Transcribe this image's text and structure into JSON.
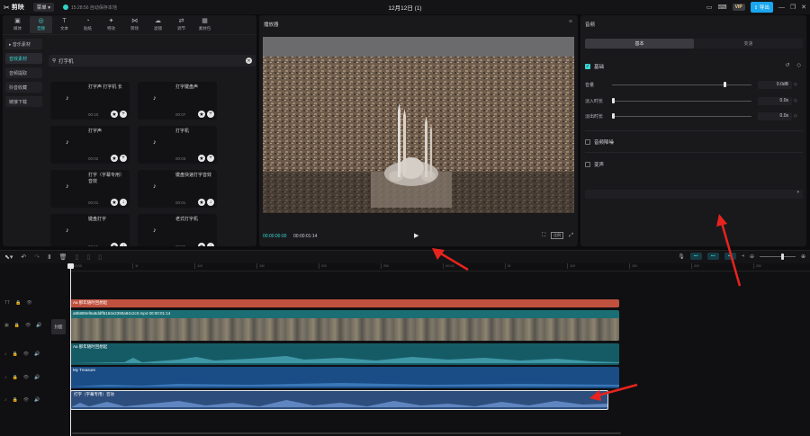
{
  "app": {
    "name": "剪映",
    "menu_label": "菜单",
    "autosave": "15:28:56 自动保存本地",
    "title": "12月12日 (1)",
    "vip": "VIP",
    "export_label": "导出"
  },
  "tools": [
    {
      "icon": "media-icon",
      "glyph": "▣",
      "label": "媒体"
    },
    {
      "icon": "audio-icon",
      "glyph": "◎",
      "label": "音频",
      "active": true
    },
    {
      "icon": "text-icon",
      "glyph": "T",
      "label": "文本"
    },
    {
      "icon": "sticker-icon",
      "glyph": "◔",
      "label": "贴纸"
    },
    {
      "icon": "effects-icon",
      "glyph": "✦",
      "label": "特效"
    },
    {
      "icon": "transition-icon",
      "glyph": "⋈",
      "label": "转场"
    },
    {
      "icon": "filter-icon",
      "glyph": "☁",
      "label": "滤镜"
    },
    {
      "icon": "adjust-icon",
      "glyph": "⇄",
      "label": "调节"
    },
    {
      "icon": "template-icon",
      "glyph": "▦",
      "label": "素材包"
    }
  ],
  "subnav": [
    "▸ 音乐素材",
    "音效素材",
    "音频提取",
    "抖音收藏",
    "链接下载"
  ],
  "search": {
    "value": "打字机"
  },
  "sounds": [
    {
      "name": "打字声 打字机 长",
      "duration": "00:10"
    },
    {
      "name": "打字键盘声",
      "duration": "00:07"
    },
    {
      "name": "打字声",
      "duration": "00:02"
    },
    {
      "name": "打字机",
      "duration": "00:03"
    },
    {
      "name": "打字（字幕专用）音效",
      "duration": "00:01"
    },
    {
      "name": "键盘快速打字音效",
      "duration": "00:01"
    },
    {
      "name": "键盘打字",
      "duration": "00:15"
    },
    {
      "name": "老式打字机",
      "duration": "00:05"
    },
    {
      "name": "键盘打字",
      "duration": ""
    },
    {
      "name": "键盘 慢速打字声",
      "duration": ""
    }
  ],
  "player": {
    "title": "播放器",
    "time_current": "00:00:00:00",
    "time_total": "00:00:01:14",
    "ratio": "比例"
  },
  "right_panel": {
    "title": "音频",
    "tabs": [
      "基本",
      "变速"
    ],
    "basic_label": "基础",
    "props": [
      {
        "label": "音量",
        "value": "0.0dB",
        "knob": 0.8
      },
      {
        "label": "淡入时长",
        "value": "0.0s",
        "knob": 0.0
      },
      {
        "label": "淡出时长",
        "value": "0.0s",
        "knob": 0.0
      }
    ],
    "denoise_label": "音频降噪",
    "voice_label": "变声"
  },
  "timeline": {
    "ruler": [
      "00:00",
      "1f",
      "10f",
      "15f",
      "20f",
      "25f",
      "00:01",
      "5f",
      "10f",
      "15f",
      "20f",
      "25f"
    ],
    "cover_label": "封面",
    "clips": {
      "text": "Aa 那年随时回想起",
      "video": "a9b880ef6a8ddff6162e2390a84c2c0.mp4   00:00:01:14",
      "audio1": "Aa 那年随时回想起",
      "audio2": "My Treasure",
      "audio3": "打字（字幕专用）音效"
    }
  },
  "colors": {
    "accent": "#38d7d0",
    "export": "#1aa6ee",
    "arrow": "#e8231e"
  }
}
